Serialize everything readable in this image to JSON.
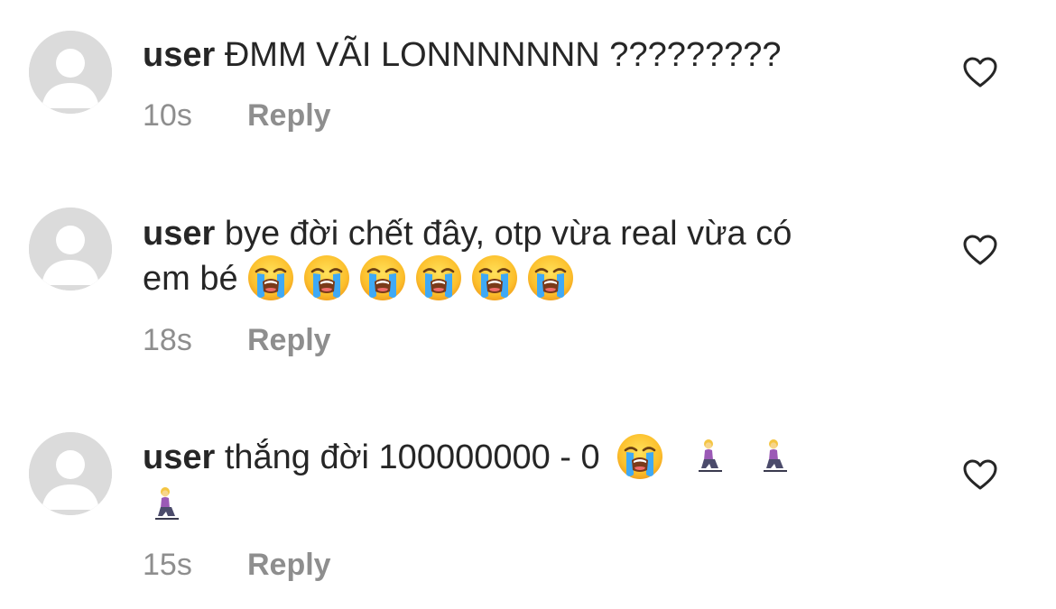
{
  "comments": [
    {
      "username": "user",
      "text": "ĐMM VÃI LONNNNNNN ?????????",
      "emojis_after_text": "",
      "timestamp": "10s",
      "reply_label": "Reply"
    },
    {
      "username": "user",
      "text_line1": "bye đời chết đây, otp vừa real vừa có",
      "text_line2": "em bé",
      "emojis_after_text": "😭😭😭😭😭😭",
      "timestamp": "18s",
      "reply_label": "Reply"
    },
    {
      "username": "user",
      "text": "thắng đời 100000000 - 0",
      "emojis_after_text": "😭🧎‍♀️🧎‍♀️🧎‍♀️",
      "timestamp": "15s",
      "reply_label": "Reply"
    }
  ],
  "icons": {
    "avatar": "default-avatar-icon",
    "like": "heart-outline-icon",
    "emoji_crying": "loudly-crying-face-emoji",
    "emoji_kneeling": "woman-kneeling-emoji"
  },
  "colors": {
    "text": "#262626",
    "secondary_text": "#8e8e8e",
    "avatar_bg": "#dbdbdb"
  }
}
